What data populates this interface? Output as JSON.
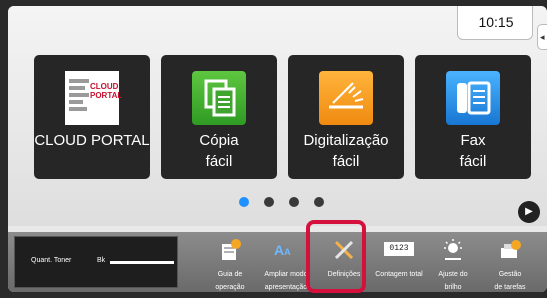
{
  "header": {
    "time": "10:15",
    "side_tab_glyph": "◂"
  },
  "tiles": [
    {
      "label": "CLOUD PORTAL",
      "icon": "cloud-portal-icon",
      "logo_text": [
        "CLOUD",
        "PORTAL"
      ]
    },
    {
      "label_line1": "Cópia",
      "label_line2": "fácil",
      "icon": "copy-icon",
      "color": "#3fa52e"
    },
    {
      "label_line1": "Digitalização",
      "label_line2": "fácil",
      "icon": "scan-icon",
      "color": "#f59b1f"
    },
    {
      "label_line1": "Fax",
      "label_line2": "fácil",
      "icon": "fax-icon",
      "color": "#1f86e0"
    }
  ],
  "pagination": {
    "pages": 4,
    "current": 1,
    "next_glyph": "▶"
  },
  "toner": {
    "label": "Quant. Toner",
    "channel": "Bk",
    "level": 1.0
  },
  "shortcuts": [
    {
      "line1": "Guia de",
      "line2": "operação",
      "icon": "guide-icon"
    },
    {
      "line1": "Ampliar modo",
      "line2": "apresentação",
      "icon": "magnify-text-icon",
      "glyph": "A",
      "glyph_small": "A"
    },
    {
      "line1": "Definições",
      "line2": "",
      "icon": "settings-tools-icon"
    },
    {
      "line1": "Contagem total",
      "line2": "",
      "icon": "counter-icon",
      "glyph": "0123"
    },
    {
      "line1": "Ajuste do",
      "line2": "brilho",
      "icon": "brightness-icon"
    },
    {
      "line1": "Gestão",
      "line2": "de tarefas",
      "icon": "job-status-icon"
    }
  ],
  "colors": {
    "highlight": "#d5103d",
    "active_dot": "#1e90ff"
  }
}
